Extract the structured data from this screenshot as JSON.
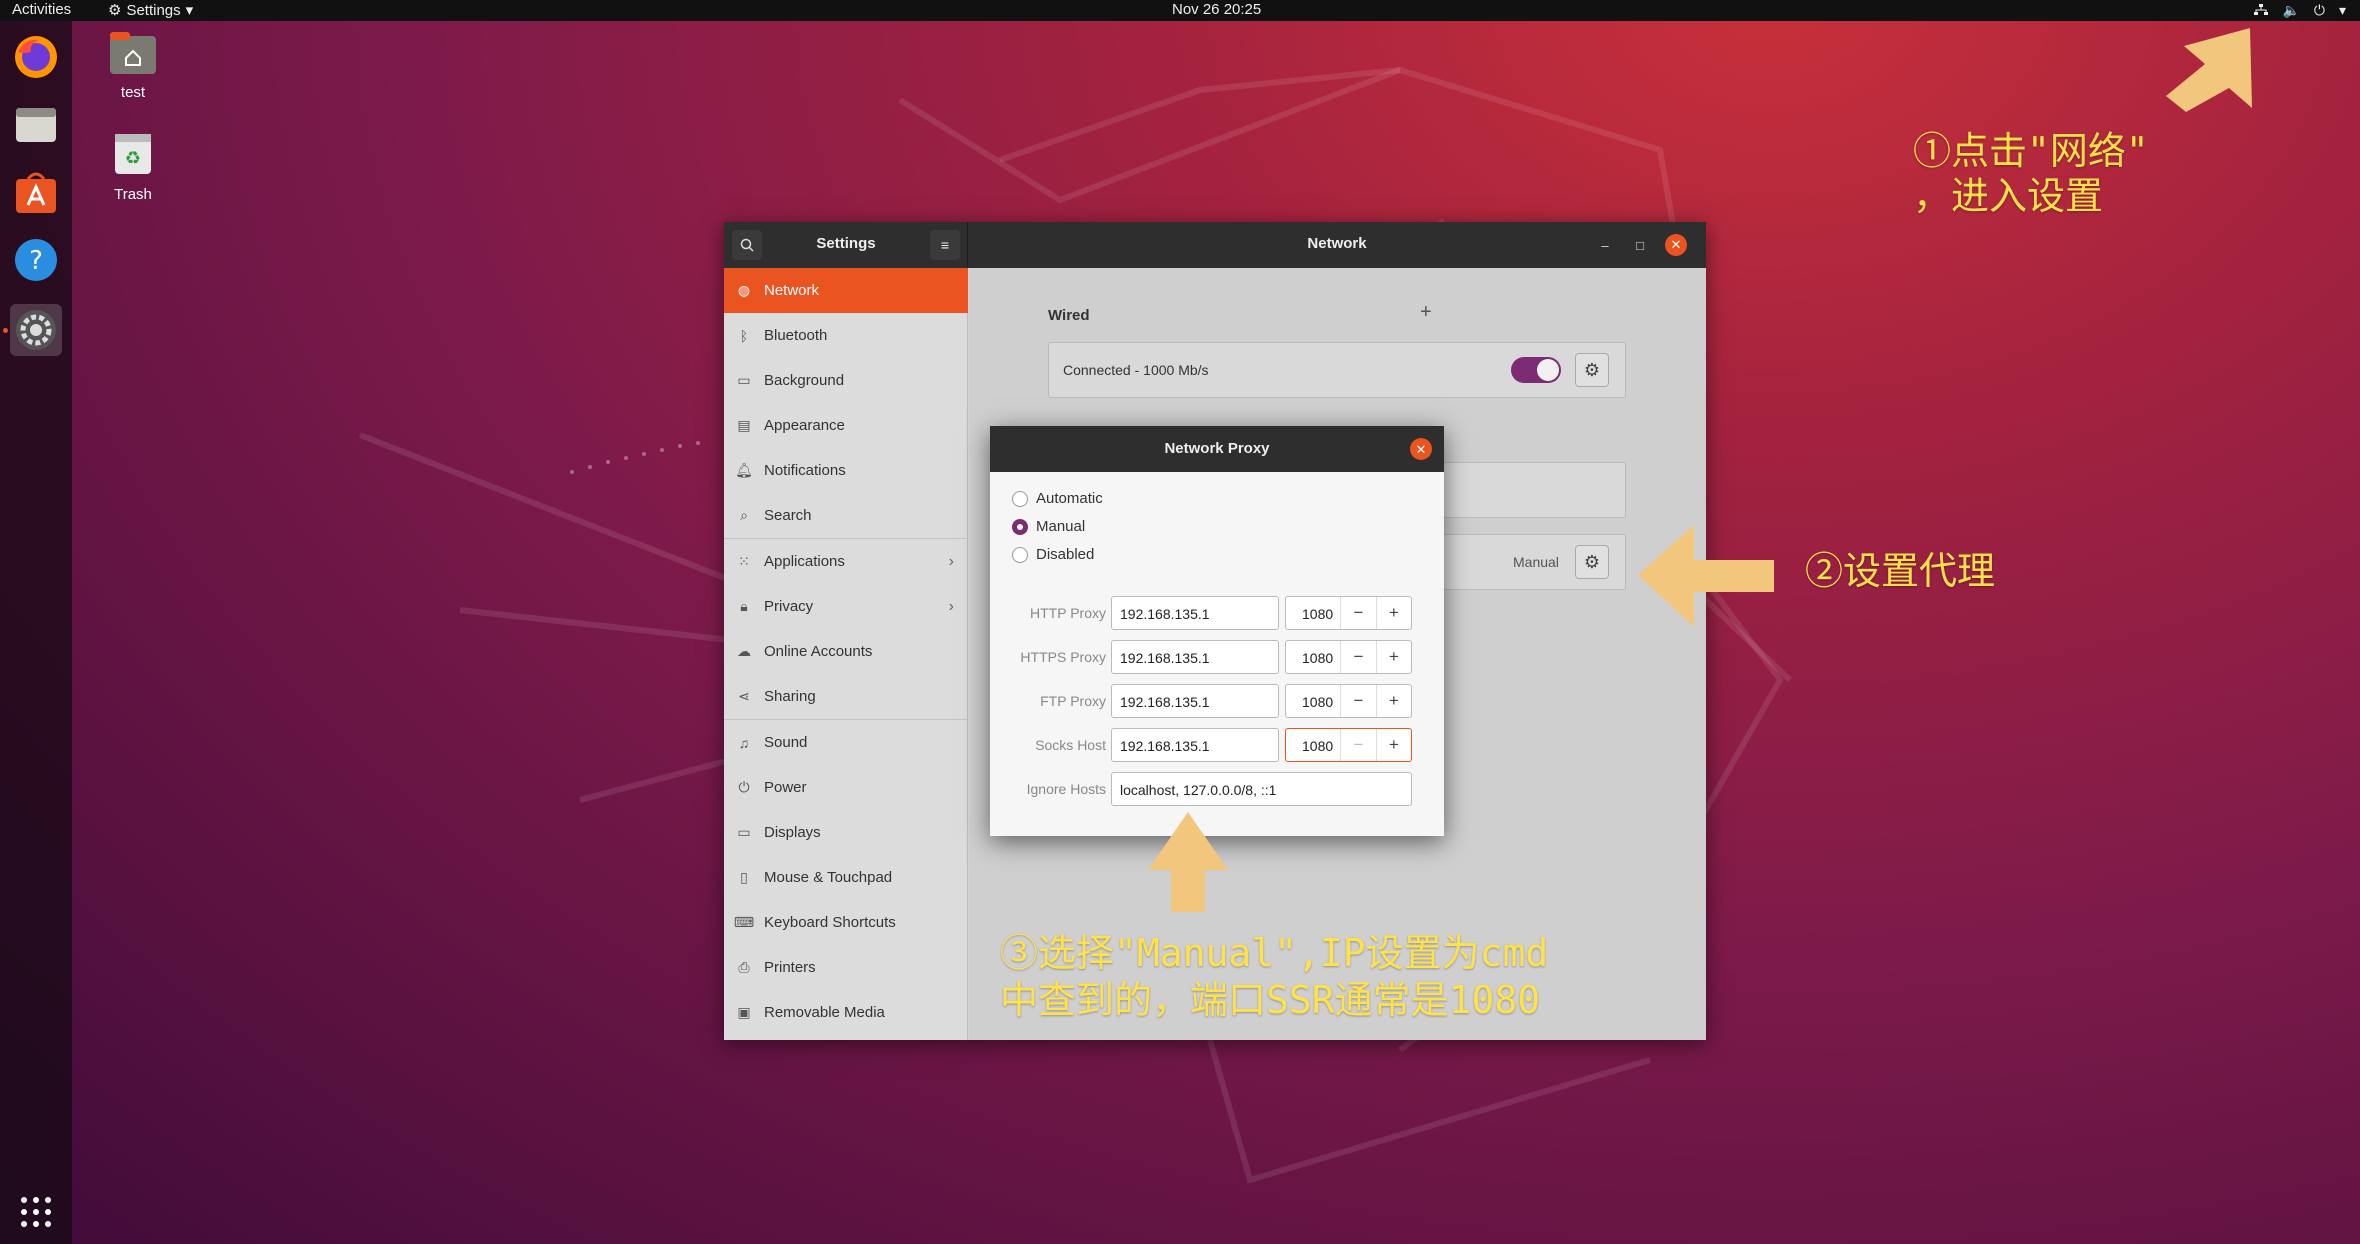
{
  "topbar": {
    "activities": "Activities",
    "app_menu": "Settings",
    "clock": "Nov 26  20:25"
  },
  "dock": {
    "items": [
      "firefox-icon",
      "files-icon",
      "software-icon",
      "help-icon",
      "settings-icon"
    ],
    "show_apps_icon": "apps-grid-icon"
  },
  "desktop": {
    "icons": [
      {
        "label": "test",
        "icon": "home-folder-icon"
      },
      {
        "label": "Trash",
        "icon": "trash-icon"
      }
    ]
  },
  "settings": {
    "sidebar_title": "Settings",
    "panel_title": "Network",
    "sidebar": [
      {
        "label": "Network",
        "icon": "network-icon",
        "active": true
      },
      {
        "label": "Bluetooth",
        "icon": "bluetooth-icon"
      },
      {
        "label": "Background",
        "icon": "background-icon"
      },
      {
        "label": "Appearance",
        "icon": "appearance-icon"
      },
      {
        "label": "Notifications",
        "icon": "bell-icon"
      },
      {
        "label": "Search",
        "icon": "search-icon"
      },
      {
        "label": "Applications",
        "icon": "grid-icon",
        "chevron": true
      },
      {
        "label": "Privacy",
        "icon": "lock-icon",
        "chevron": true
      },
      {
        "label": "Online Accounts",
        "icon": "cloud-icon"
      },
      {
        "label": "Sharing",
        "icon": "share-icon"
      },
      {
        "label": "Sound",
        "icon": "music-icon"
      },
      {
        "label": "Power",
        "icon": "power-icon"
      },
      {
        "label": "Displays",
        "icon": "display-icon"
      },
      {
        "label": "Mouse & Touchpad",
        "icon": "mouse-icon"
      },
      {
        "label": "Keyboard Shortcuts",
        "icon": "keyboard-icon"
      },
      {
        "label": "Printers",
        "icon": "printer-icon"
      },
      {
        "label": "Removable Media",
        "icon": "media-icon"
      }
    ],
    "wired": {
      "title": "Wired",
      "status": "Connected - 1000 Mb/s",
      "enabled": true
    },
    "proxy_row": {
      "value": "Manual"
    }
  },
  "proxy_dialog": {
    "title": "Network Proxy",
    "modes": [
      {
        "label": "Automatic",
        "selected": false
      },
      {
        "label": "Manual",
        "selected": true
      },
      {
        "label": "Disabled",
        "selected": false
      }
    ],
    "rows": [
      {
        "label": "HTTP Proxy",
        "host": "192.168.135.1",
        "port": "1080"
      },
      {
        "label": "HTTPS Proxy",
        "host": "192.168.135.1",
        "port": "1080"
      },
      {
        "label": "FTP Proxy",
        "host": "192.168.135.1",
        "port": "1080"
      },
      {
        "label": "Socks Host",
        "host": "192.168.135.1",
        "port": "1080"
      }
    ],
    "ignore_label": "Ignore Hosts",
    "ignore_value": "localhost, 127.0.0.0/8, ::1"
  },
  "annotations": {
    "step1_line1": "①点击\"网络\"",
    "step1_line2": "，进入设置",
    "step2": "②设置代理",
    "step3_line1": "③选择\"Manual\",IP设置为cmd",
    "step3_line2": "中查到的，端口SSR通常是1080",
    "arrow_color": "#f2c67c",
    "text_color": "#ffe24a"
  }
}
